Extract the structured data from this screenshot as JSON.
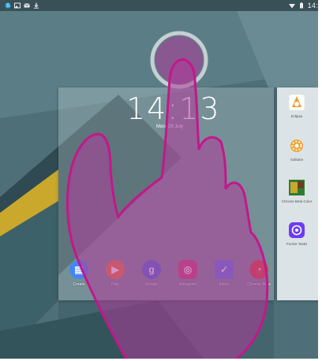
{
  "status_bar": {
    "time": "14:1",
    "left_icons": [
      "skype-icon",
      "image-icon",
      "mail-icon",
      "download-icon"
    ],
    "right_icons": [
      "wifi-icon",
      "battery-icon"
    ]
  },
  "lockscreen": {
    "clock": "14:13",
    "date": "Mon, 29 July"
  },
  "dock": {
    "apps": [
      {
        "label": "Create",
        "icon": "docs-icon",
        "color": "#4285f4",
        "glyph": "▤"
      },
      {
        "label": "Play",
        "icon": "play-icon",
        "color": "#e57c3a",
        "glyph": "▶"
      },
      {
        "label": "Google",
        "icon": "google-plus-icon",
        "color": "#4a6fd4",
        "glyph": "g"
      },
      {
        "label": "Instagram",
        "icon": "instagram-icon",
        "color": "#c34b77",
        "glyph": "◎"
      },
      {
        "label": "Inbox",
        "icon": "inbox-icon",
        "color": "#5a7de2",
        "glyph": "✓"
      },
      {
        "label": "Chrome Beta",
        "icon": "chrome-icon",
        "color": "#d44638",
        "glyph": "◔"
      }
    ]
  },
  "recent_apps": [
    {
      "label": "Eclipse",
      "icon": "eclipse-app-icon",
      "color": "#f29b26"
    },
    {
      "label": "Solitaire",
      "icon": "settings-gear-icon",
      "color": "#f0a22e"
    },
    {
      "label": "Chrome Beta Color",
      "icon": "photo-app-icon",
      "color": "#2e7d32"
    },
    {
      "label": "Pocket Tasks",
      "icon": "tasks-app-icon",
      "color": "#6c3cf2"
    }
  ],
  "colors": {
    "wallpaper_base": "#4f6f78",
    "wallpaper_dark": "#2f4a52",
    "wallpaper_yellow": "#c9a82b",
    "hand_fill": "#b03a9a",
    "hand_stroke": "#c2188a",
    "touch_ring": "#d9dde0"
  }
}
